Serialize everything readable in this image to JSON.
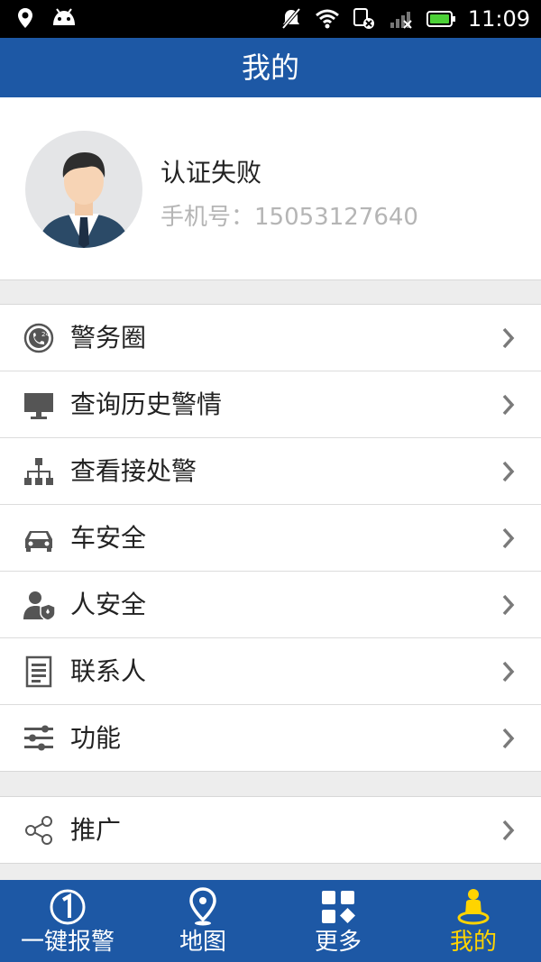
{
  "status_bar": {
    "time": "11:09"
  },
  "header": {
    "title": "我的"
  },
  "profile": {
    "name": "认证失败",
    "phone": "手机号：15053127640"
  },
  "menu": [
    {
      "label": "警务圈",
      "icon": "phone-24-icon"
    },
    {
      "label": "查询历史警情",
      "icon": "monitor-icon"
    },
    {
      "label": "查看接处警",
      "icon": "org-chart-icon"
    },
    {
      "label": "车安全",
      "icon": "car-icon"
    },
    {
      "label": "人安全",
      "icon": "person-shield-icon"
    },
    {
      "label": "联系人",
      "icon": "contact-list-icon"
    },
    {
      "label": "功能",
      "icon": "sliders-icon"
    }
  ],
  "extra_menu": [
    {
      "label": "推广",
      "icon": "share-icon"
    }
  ],
  "tabs": [
    {
      "label": "一键报警",
      "icon": "alarm-one-icon",
      "active": false
    },
    {
      "label": "地图",
      "icon": "map-pin-icon",
      "active": false
    },
    {
      "label": "更多",
      "icon": "grid-more-icon",
      "active": false
    },
    {
      "label": "我的",
      "icon": "person-icon",
      "active": true
    }
  ],
  "colors": {
    "primary": "#1d58a5",
    "active_tab": "#ffd400",
    "muted_text": "#b5b5b5"
  }
}
